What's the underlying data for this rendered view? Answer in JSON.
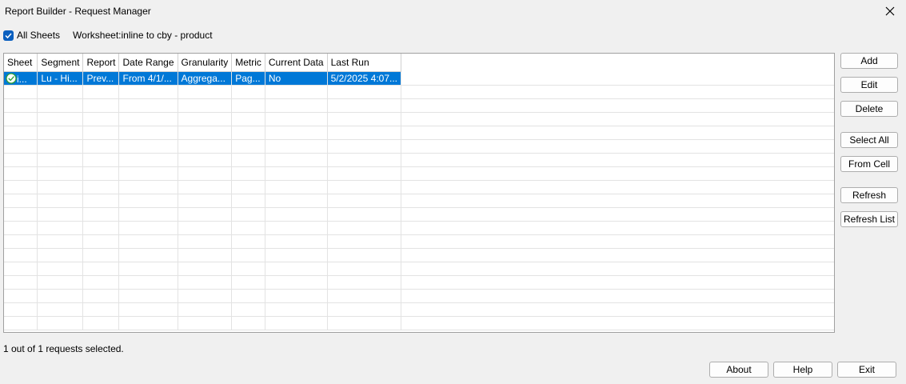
{
  "window": {
    "title": "Report Builder - Request Manager",
    "close_icon": "close-icon"
  },
  "toolbar": {
    "all_sheets_label": "All Sheets",
    "all_sheets_checked": true,
    "worksheet_label": "Worksheet:inline to cby - product"
  },
  "table": {
    "columns": [
      "Sheet",
      "Segment",
      "Report",
      "Date Range",
      "Granularity",
      "Metric",
      "Current Data",
      "Last Run"
    ],
    "rows": [
      {
        "status_icon": "check-circle-icon",
        "sheet": "i...",
        "segment": "Lu - Hi...",
        "report": "Prev...",
        "date_range": "From 4/1/...",
        "granularity": "Aggrega...",
        "metric": "Pag...",
        "current_data": "No",
        "last_run": "5/2/2025 4:07..."
      }
    ]
  },
  "side_buttons": {
    "add": "Add",
    "edit": "Edit",
    "delete": "Delete",
    "select_all": "Select All",
    "from_cell": "From Cell",
    "refresh": "Refresh",
    "refresh_list": "Refresh List"
  },
  "status": "1 out of 1 requests selected.",
  "bottom_buttons": {
    "about": "About",
    "help": "Help",
    "exit": "Exit"
  },
  "colors": {
    "selection": "#0078d7",
    "check_green": "#2e9e3a",
    "checkbox_blue": "#0a5fbf"
  }
}
